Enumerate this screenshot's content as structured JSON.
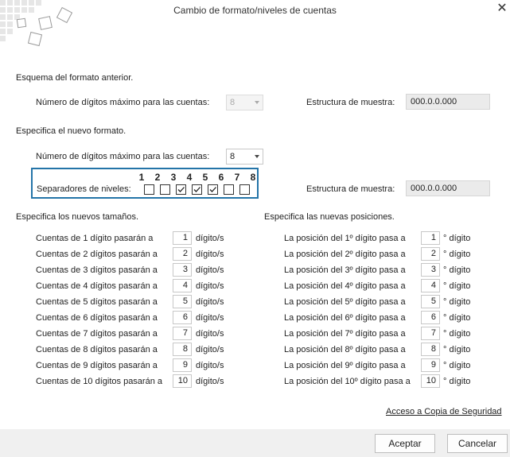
{
  "window": {
    "title": "Cambio de formato/niveles de cuentas",
    "close_glyph": "✕"
  },
  "previous": {
    "heading": "Esquema del formato anterior.",
    "max_digits_label": "Número de dígitos máximo para las cuentas:",
    "max_digits_value": "8",
    "sample_label": "Estructura de muestra:",
    "sample_value": "000.0.0.000"
  },
  "new_format": {
    "heading": "Especifica el nuevo formato.",
    "max_digits_label": "Número de dígitos máximo para las cuentas:",
    "max_digits_value": "8",
    "separators_label": "Separadores de niveles:",
    "separator_numbers": [
      "1",
      "2",
      "3",
      "4",
      "5",
      "6",
      "7",
      "8"
    ],
    "separator_checked": [
      false,
      false,
      true,
      true,
      true,
      false,
      false
    ],
    "sample_label": "Estructura de muestra:",
    "sample_value": "000.0.0.000"
  },
  "sizes": {
    "heading": "Especifica los nuevos tamaños.",
    "unit": "dígito/s",
    "rows": [
      {
        "label": "Cuentas de 1 dígito pasarán a",
        "value": "1"
      },
      {
        "label": "Cuentas de 2 dígitos pasarán a",
        "value": "2"
      },
      {
        "label": "Cuentas de 3 dígitos pasarán a",
        "value": "3"
      },
      {
        "label": "Cuentas de 4 dígitos pasarán a",
        "value": "4"
      },
      {
        "label": "Cuentas de 5 dígitos pasarán a",
        "value": "5"
      },
      {
        "label": "Cuentas de 6 dígitos pasarán a",
        "value": "6"
      },
      {
        "label": "Cuentas de 7 dígitos pasarán a",
        "value": "7"
      },
      {
        "label": "Cuentas de 8 dígitos pasarán a",
        "value": "8"
      },
      {
        "label": "Cuentas de 9 dígitos pasarán a",
        "value": "9"
      },
      {
        "label": "Cuentas de 10 dígitos pasarán a",
        "value": "10"
      }
    ]
  },
  "positions": {
    "heading": "Especifica las nuevas posiciones.",
    "unit": "° dígito",
    "rows": [
      {
        "label": "La posición del 1º dígito pasa a",
        "value": "1"
      },
      {
        "label": "La posición del 2º dígito pasa a",
        "value": "2"
      },
      {
        "label": "La posición del 3º dígito pasa a",
        "value": "3"
      },
      {
        "label": "La posición del 4º dígito pasa a",
        "value": "4"
      },
      {
        "label": "La posición del 5º dígito pasa a",
        "value": "5"
      },
      {
        "label": "La posición del 6º dígito pasa a",
        "value": "6"
      },
      {
        "label": "La posición del 7º dígito pasa a",
        "value": "7"
      },
      {
        "label": "La posición del 8º dígito pasa a",
        "value": "8"
      },
      {
        "label": "La posición del 9º dígito pasa a",
        "value": "9"
      },
      {
        "label": "La posición del 10º dígito pasa a",
        "value": "10"
      }
    ]
  },
  "backup_link": "Acceso a Copia de Seguridad",
  "buttons": {
    "accept": "Aceptar",
    "cancel": "Cancelar"
  },
  "colors": {
    "accent_border": "#2474a8",
    "footer_bg": "#f0f0f0",
    "sample_bg": "#ebebeb"
  }
}
